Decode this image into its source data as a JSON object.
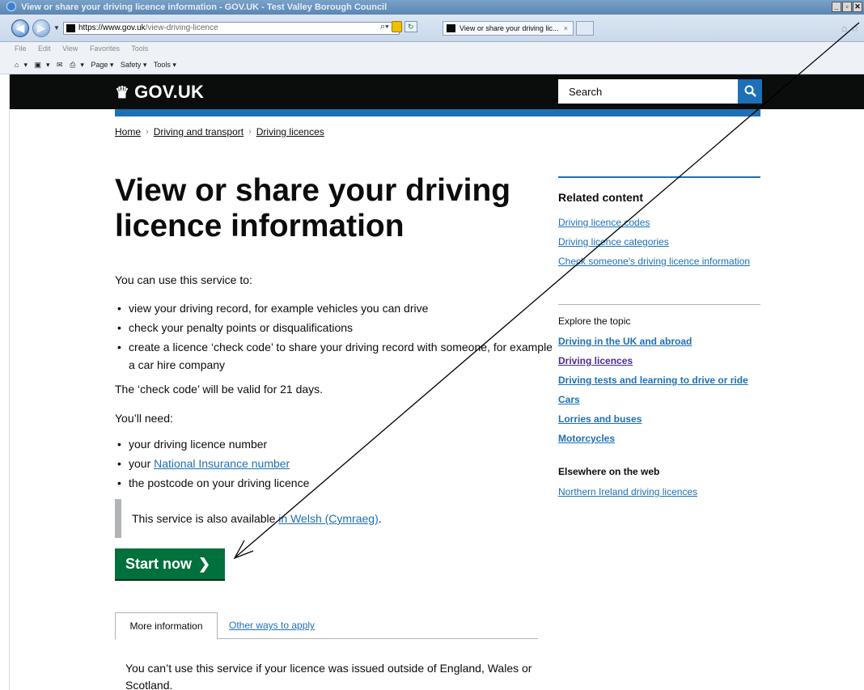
{
  "browser": {
    "window_title": "View or share your driving licence information - GOV.UK - Test Valley Borough Council",
    "address_host": "https://www.gov.uk",
    "address_path": "/view-driving-licence",
    "tab_title": "View or share your driving lic...",
    "tab_close": "×",
    "menu": [
      "File",
      "Edit",
      "View",
      "Favorites",
      "Tools"
    ],
    "commands": [
      "▾",
      "▾",
      "▾",
      "Page ▾",
      "Safety ▾",
      "Tools ▾"
    ],
    "win_buttons": [
      "_",
      "▫",
      "✕"
    ]
  },
  "header": {
    "logo_text": "GOV.UK",
    "logo_icon": "crown-icon",
    "search_placeholder": "Search",
    "search_icon": "search-icon"
  },
  "breadcrumb": [
    "Home",
    "Driving and transport",
    "Driving licences"
  ],
  "main": {
    "title": "View or share your driving licence information",
    "intro": "You can use this service to:",
    "bullets_use": [
      "view your driving record, for example vehicles you can drive",
      "check your penalty points or disqualifications",
      "create a licence ‘check code’ to share your driving record with someone, for example a car hire company"
    ],
    "valid_text": "The ‘check code’ will be valid for 21 days.",
    "need_text": "You’ll need:",
    "need_1": "your driving licence number",
    "need_2_prefix": "your ",
    "need_2_link": "National Insurance number",
    "need_3": "the postcode on your driving licence",
    "inset_prefix": "This service is also available ",
    "inset_link": "in Welsh (Cymraeg)",
    "inset_suffix": ".",
    "start_label": "Start now",
    "start_chevron": "❯",
    "tab_more": "More information",
    "tab_other": "Other ways to apply",
    "tab_text": "You can’t use this service if your licence was issued outside of England, Wales or Scotland."
  },
  "sidebar": {
    "related_heading": "Related content",
    "related": [
      "Driving licence codes",
      "Driving licence categories",
      "Check someone's driving licence information"
    ],
    "explore_heading": "Explore the topic",
    "topics": [
      "Driving in the UK and abroad",
      "Driving licences",
      "Driving tests and learning to drive or ride",
      "Cars",
      "Lorries and buses",
      "Motorcycles"
    ],
    "elsewhere_heading": "Elsewhere on the web",
    "elsewhere": [
      "Northern Ireland driving licences"
    ]
  },
  "colors": {
    "brand_black": "#0b0c0c",
    "link_blue": "#1d70b8",
    "visited_purple": "#4c2c92",
    "start_green": "#00703c",
    "inset_grey": "#b1b4b6"
  }
}
